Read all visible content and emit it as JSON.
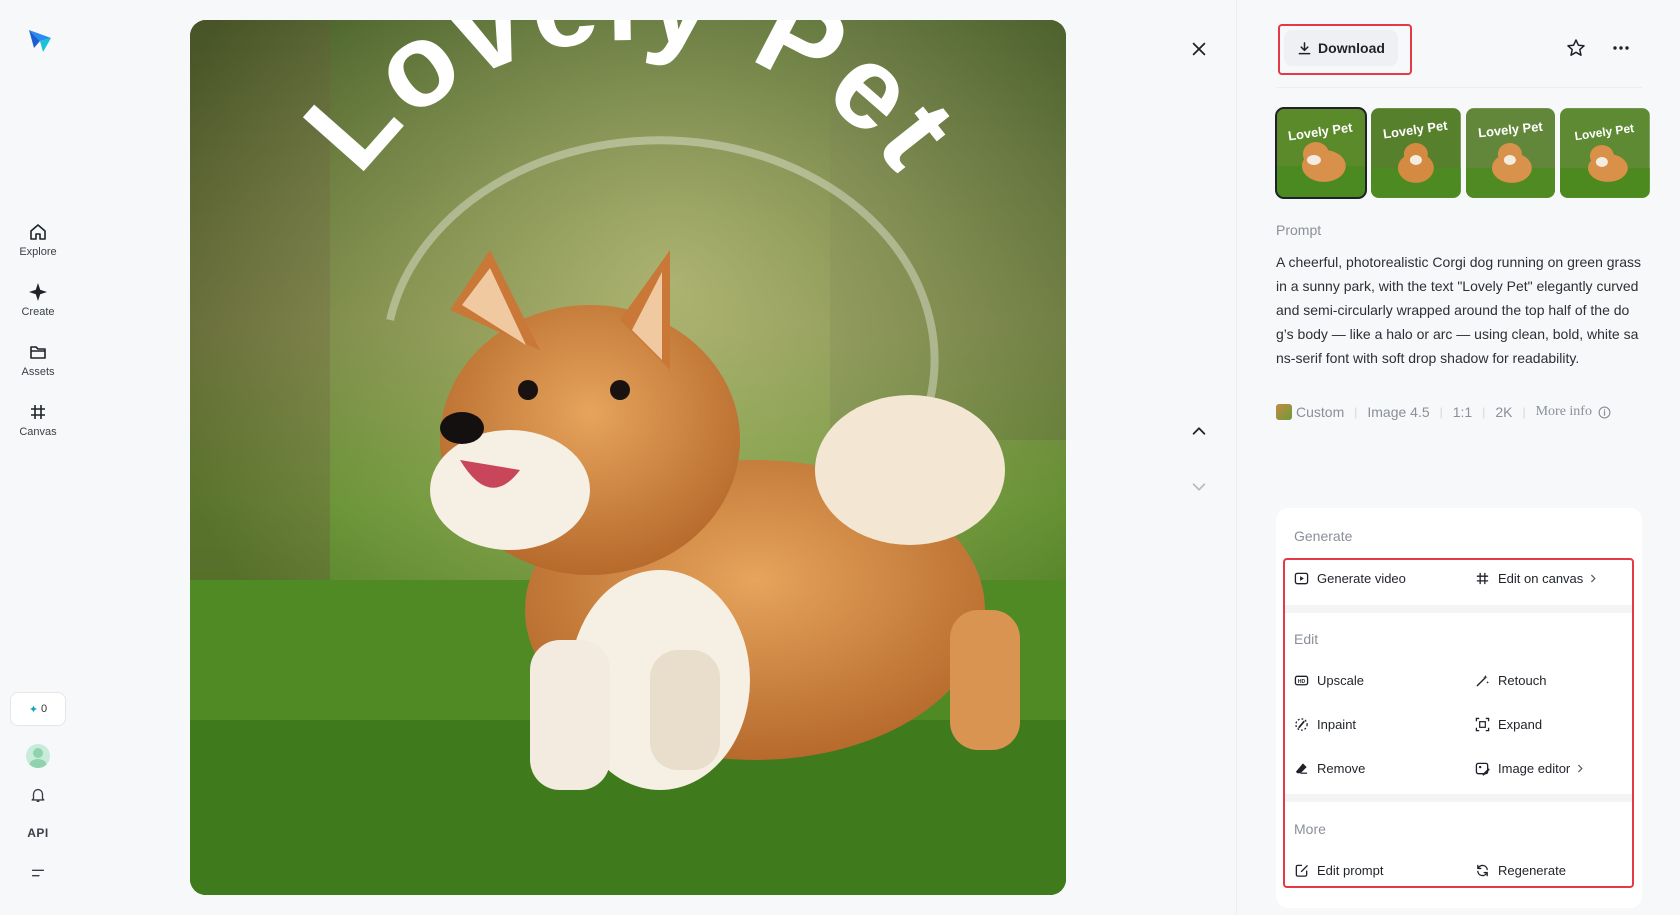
{
  "nav": {
    "items": [
      {
        "label": "Explore",
        "icon": "home-icon"
      },
      {
        "label": "Create",
        "icon": "sparkle-icon"
      },
      {
        "label": "Assets",
        "icon": "folder-icon"
      },
      {
        "label": "Canvas",
        "icon": "canvas-icon"
      }
    ],
    "credits": "0",
    "api_label": "API"
  },
  "image": {
    "overlay_text": "Lovely Pet"
  },
  "toolbar": {
    "download_label": "Download"
  },
  "thumbnails": [
    {
      "text": "Lovely Pet",
      "selected": true
    },
    {
      "text": "Lovely Pet",
      "selected": false
    },
    {
      "text": "Lovely Pet",
      "selected": false
    },
    {
      "text": "Lovely Pet",
      "selected": false
    }
  ],
  "prompt": {
    "label": "Prompt",
    "text": "A cheerful, photorealistic Corgi dog running on green grass in a sunny park, with the text \"Lovely Pet\" elegantly curved and semi-circularly wrapped around the top half of the dog’s body — like a halo or arc — using clean, bold, white sans-serif font with soft drop shadow for readability."
  },
  "meta": {
    "style": "Custom",
    "model": "Image 4.5",
    "ratio": "1:1",
    "resolution": "2K",
    "more_info": "More info"
  },
  "actions": {
    "generate_title": "Generate",
    "generate_video": "Generate video",
    "edit_on_canvas": "Edit on canvas",
    "edit_title": "Edit",
    "upscale": "Upscale",
    "retouch": "Retouch",
    "inpaint": "Inpaint",
    "expand": "Expand",
    "remove": "Remove",
    "image_editor": "Image editor",
    "more_title": "More",
    "edit_prompt": "Edit prompt",
    "regenerate": "Regenerate"
  },
  "colors": {
    "highlight": "#e53945",
    "grass": "#4e7a2a",
    "corgi": "#d8904a"
  }
}
